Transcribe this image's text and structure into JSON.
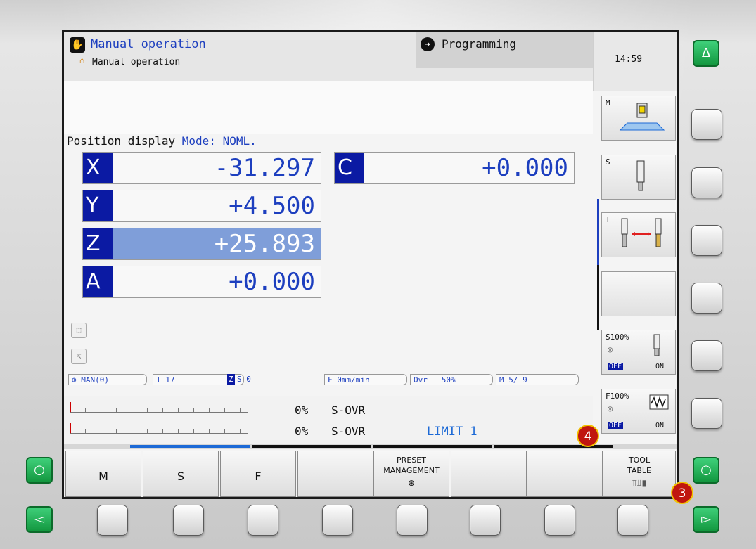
{
  "header": {
    "mode_title": "Manual operation",
    "mode_subtitle": "Manual operation",
    "programming_tab": "Programming",
    "clock": "14:59"
  },
  "position_display": {
    "title": "Position display",
    "mode": "Mode: NOML.",
    "axes": [
      {
        "letter": "X",
        "value": "-31.297"
      },
      {
        "letter": "Y",
        "value": "+4.500"
      },
      {
        "letter": "Z",
        "value": "+25.893",
        "active": true
      },
      {
        "letter": "A",
        "value": "+0.000"
      },
      {
        "letter": "C",
        "value": "+0.000"
      }
    ]
  },
  "status_bar": {
    "mode": "MAN(0)",
    "tool": "T 17",
    "axis": "Z",
    "spindle": "S 0",
    "feed": "F 0mm/min",
    "ovr_label": "Ovr",
    "ovr_value": "50%",
    "m_func": "M 5/ 9"
  },
  "overrides": [
    {
      "pct": "0%",
      "label": "S-OVR"
    },
    {
      "pct": "0%",
      "label": "S-OVR"
    }
  ],
  "limit": "LIMIT 1",
  "side_softkeys": {
    "m_label": "M",
    "s_label": "S",
    "t_label": "T",
    "s100": "S100%",
    "f100": "F100%",
    "off": "OFF",
    "on": "ON"
  },
  "softkeys": {
    "m": "M",
    "s": "S",
    "f": "F",
    "preset_line1": "PRESET",
    "preset_line2": "MANAGEMENT",
    "tool_line1": "TOOL",
    "tool_line2": "TABLE"
  },
  "badges": {
    "b3": "3",
    "b4": "4"
  },
  "green_keys": {
    "up": "Δ",
    "left": "◅",
    "right": "▻",
    "cycle": "○"
  },
  "colors": {
    "axis_letter_bg": "#0b1aa3",
    "active_axis_bg": "#7f9ed9",
    "badge": "#c0160f",
    "green_key": "#12963e"
  }
}
